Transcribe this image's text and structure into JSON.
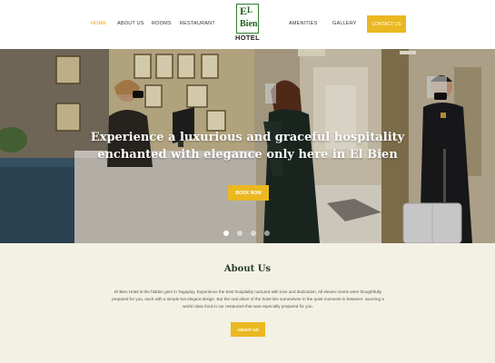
{
  "nav": {
    "items": [
      {
        "label": "HOME",
        "active": true
      },
      {
        "label": "ABOUT US",
        "active": false
      },
      {
        "label": "ROOMS",
        "active": false
      },
      {
        "label": "RESTAURANT",
        "active": false
      },
      {
        "label": "AMENITIES",
        "active": false
      },
      {
        "label": "GALLERY",
        "active": false
      }
    ],
    "contact_label": "CONTACT US"
  },
  "logo": {
    "letter_e": "E",
    "letter_l": "L",
    "word_bien": "Bien",
    "word_hotel": "HOTEL"
  },
  "hero": {
    "heading": "Experience a luxurious and graceful hospitality enchanted with elegance only here in El Bien",
    "cta_label": "BOOK NOW",
    "slide_count": 4,
    "active_slide": 1
  },
  "about": {
    "title": "About Us",
    "body": "El Bien Hotel is the hidden gem in Tagaytay. Experience the best hospitality nurtured with love and dedication. All eleven rooms were thoughtfully prepared for you, each with a simple but elegant design. But the real allure of the hotel lies somewhere in the quiet moments in between: savoring a world class food in our restaurant that was especially prepared for you.",
    "cta_label": "ABOUT US"
  },
  "colors": {
    "accent": "#eab821",
    "active_nav": "#e6a615",
    "section_bg": "#f3f1e3",
    "heading_dark": "#2a3d33",
    "logo_green": "#2f7d2f"
  }
}
